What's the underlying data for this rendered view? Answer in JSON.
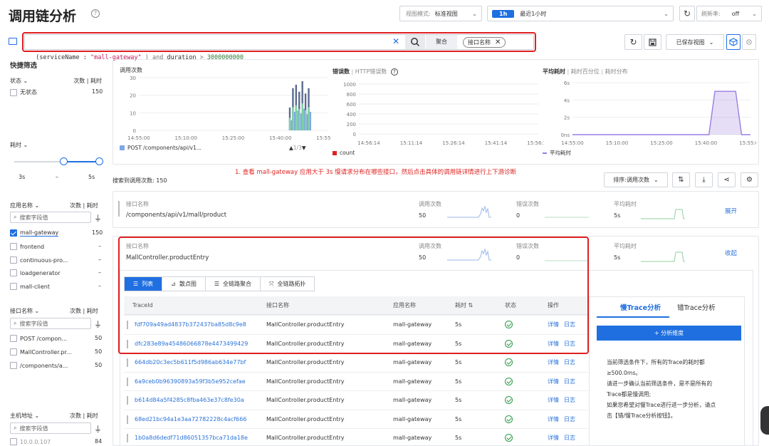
{
  "header": {
    "title": "调用链分析",
    "view_mode_label": "视图模式:",
    "view_mode_value": "标准视图",
    "time_badge": "1h",
    "time_range": "最近1小时",
    "refresh_label": "刷新率:",
    "refresh_value": "off"
  },
  "query": {
    "text_key": "(serviceName : ",
    "text_val": "\"mall-gateway\"",
    "text_and": " ) and ",
    "text_field": "duration",
    "text_op": " > ",
    "text_num": "3000000000",
    "aggregate_label": "聚合",
    "tag_label": "接口名称",
    "saved_view": "已保存视图"
  },
  "sidebar": {
    "title": "快捷筛选",
    "status": {
      "label": "状态",
      "cols": "次数 | 耗时",
      "items": [
        {
          "label": "无状态",
          "count": "150"
        }
      ]
    },
    "duration": {
      "label": "耗时",
      "min": "3s",
      "dash": "–",
      "max": "5s"
    },
    "app": {
      "label": "应用名称",
      "cols": "次数 | 耗时",
      "placeholder": "搜索字段值",
      "items": [
        {
          "label": "mall-gateway",
          "count": "150",
          "checked": true
        },
        {
          "label": "frontend",
          "count": "–"
        },
        {
          "label": "continuous-pro...",
          "count": "–"
        },
        {
          "label": "loadgenerator",
          "count": "–"
        },
        {
          "label": "mall-client",
          "count": "–"
        }
      ]
    },
    "api": {
      "label": "接口名称",
      "cols": "次数 | 耗时",
      "placeholder": "搜索字段值",
      "items": [
        {
          "label": "POST /compon...",
          "count": "50"
        },
        {
          "label": "MallController.pr...",
          "count": "50"
        },
        {
          "label": "/components/a...",
          "count": "50"
        }
      ]
    },
    "host": {
      "label": "主机地址",
      "cols": "次数 | 耗时",
      "placeholder": "搜索字段值",
      "items": [
        {
          "label": "10.0.0.107",
          "count": "84"
        }
      ]
    }
  },
  "charts": {
    "calls": {
      "title": "调用次数",
      "legend": "POST /components/api/v1...",
      "pager": "1/3",
      "yticks": [
        "30",
        "20",
        "10",
        "0"
      ],
      "xticks": [
        "14:55:00",
        "15:10:00",
        "15:25:00",
        "15:40:00",
        "15:55:00"
      ]
    },
    "errors": {
      "tab1": "错误数",
      "tab2": "HTTP错误数",
      "legend": "count",
      "yticks": [
        "1000",
        "800",
        "600",
        "400",
        "200",
        "0"
      ],
      "xticks": [
        "14:56:14",
        "15:11:14",
        "15:26:14",
        "15:41:14",
        "15:56:14"
      ]
    },
    "latency": {
      "tab1": "平均耗时",
      "tab2": "耗时百分位",
      "tab3": "耗时分布",
      "legend": "平均耗时",
      "yticks": [
        "6s",
        "4s",
        "2s",
        "0ns"
      ],
      "xticks": [
        "14:55:00",
        "15:10:00",
        "15:25:00",
        "15:40:00",
        "15:55:00"
      ]
    }
  },
  "chart_data": [
    {
      "type": "bar",
      "title": "调用次数",
      "ylim": [
        0,
        30
      ],
      "xlim": [
        "14:55:00",
        "15:55:00"
      ],
      "series": [
        {
          "name": "POST /components/api/v1..."
        }
      ],
      "bursts": [
        {
          "x": "15:43:00",
          "value": 13
        },
        {
          "x": "15:44:00",
          "value": 24
        },
        {
          "x": "15:45:00",
          "value": 26
        },
        {
          "x": "15:46:00",
          "value": 22
        },
        {
          "x": "15:47:00",
          "value": 28
        },
        {
          "x": "15:48:00",
          "value": 21
        },
        {
          "x": "15:49:00",
          "value": 24
        }
      ]
    },
    {
      "type": "line",
      "title": "错误数",
      "ylim": [
        0,
        1000
      ],
      "series": [
        {
          "name": "count",
          "values": []
        }
      ]
    },
    {
      "type": "line",
      "title": "平均耗时",
      "ylim": [
        0,
        6
      ],
      "series": [
        {
          "name": "平均耗时",
          "x": [
            "14:55:00",
            "15:41:00",
            "15:43:00",
            "15:50:00",
            "15:52:00",
            "15:55:00"
          ],
          "values": [
            0,
            0,
            5,
            5,
            0,
            0
          ]
        }
      ]
    }
  ],
  "annotation": "1. 查看 mall-gateway 应用大于 3s 慢请求分布在哪些接口，然后点击具体的调用链详情进行上下游诊断",
  "results": {
    "count_label": "搜索到调用次数:",
    "count": "150",
    "sort_label": "排序:调用次数"
  },
  "groups": [
    {
      "name_label": "接口名称",
      "name": "/components/api/v1/mall/product",
      "calls_label": "调用次数",
      "calls": "50",
      "errors_label": "错误次数",
      "errors": "0",
      "avg_label": "平均耗时",
      "avg": "5s",
      "action": "展开"
    },
    {
      "name_label": "接口名称",
      "name": "MallController.productEntry",
      "calls_label": "调用次数",
      "calls": "50",
      "errors_label": "错误次数",
      "errors": "0",
      "avg_label": "平均耗时",
      "avg": "5s",
      "action": "收起"
    }
  ],
  "tabs": [
    "列表",
    "散点图",
    "全链路聚合",
    "全链路拓扑"
  ],
  "table": {
    "headers": [
      "TraceId",
      "接口名称",
      "应用名称",
      "耗时",
      "状态",
      "操作"
    ],
    "action1": "详情",
    "action2": "日志",
    "rows": [
      {
        "id": "fdf709a49ad4837b372437ba85d8c9e8",
        "api": "MallController.productEntry",
        "app": "mall-gateway",
        "dur": "5s"
      },
      {
        "id": "dfc283e89a45486066878e4473499429",
        "api": "MallController.productEntry",
        "app": "mall-gateway",
        "dur": "5s"
      },
      {
        "id": "664db20c3ec5b611f5d986ab634e77bf",
        "api": "MallController.productEntry",
        "app": "mall-gateway",
        "dur": "5s"
      },
      {
        "id": "6a9ceb0b96390893a59f3b5e952cefae",
        "api": "MallController.productEntry",
        "app": "mall-gateway",
        "dur": "5s"
      },
      {
        "id": "b614d84a5f4285c8fba463e37c8fe30a",
        "api": "MallController.productEntry",
        "app": "mall-gateway",
        "dur": "5s"
      },
      {
        "id": "68ed21bc94a1e3aa72782228c4acf666",
        "api": "MallController.productEntry",
        "app": "mall-gateway",
        "dur": "5s"
      },
      {
        "id": "1b0a8d6dedf71d86051357bca71da18e",
        "api": "MallController.productEntry",
        "app": "mall-gateway",
        "dur": "5s"
      }
    ]
  },
  "analysis": {
    "tab_slow": "慢Trace分析",
    "tab_err": "错Trace分析",
    "add_dim": "+ 分析维度",
    "text1": "当前筛选条件下，所有的Trace的耗时都",
    "text2": "≥500.0ms。",
    "text3": "请进一步确认当前筛选条件，是不是所有的",
    "text4": "Trace都是慢调用;",
    "text5": "如果您希望对慢Trace进行进一步分析，请点",
    "text6": "击【错/慢Trace分析按钮】。"
  },
  "colors": {
    "accent": "#1f6fe0",
    "red": "#e02020",
    "ok": "#2e9b4a"
  }
}
